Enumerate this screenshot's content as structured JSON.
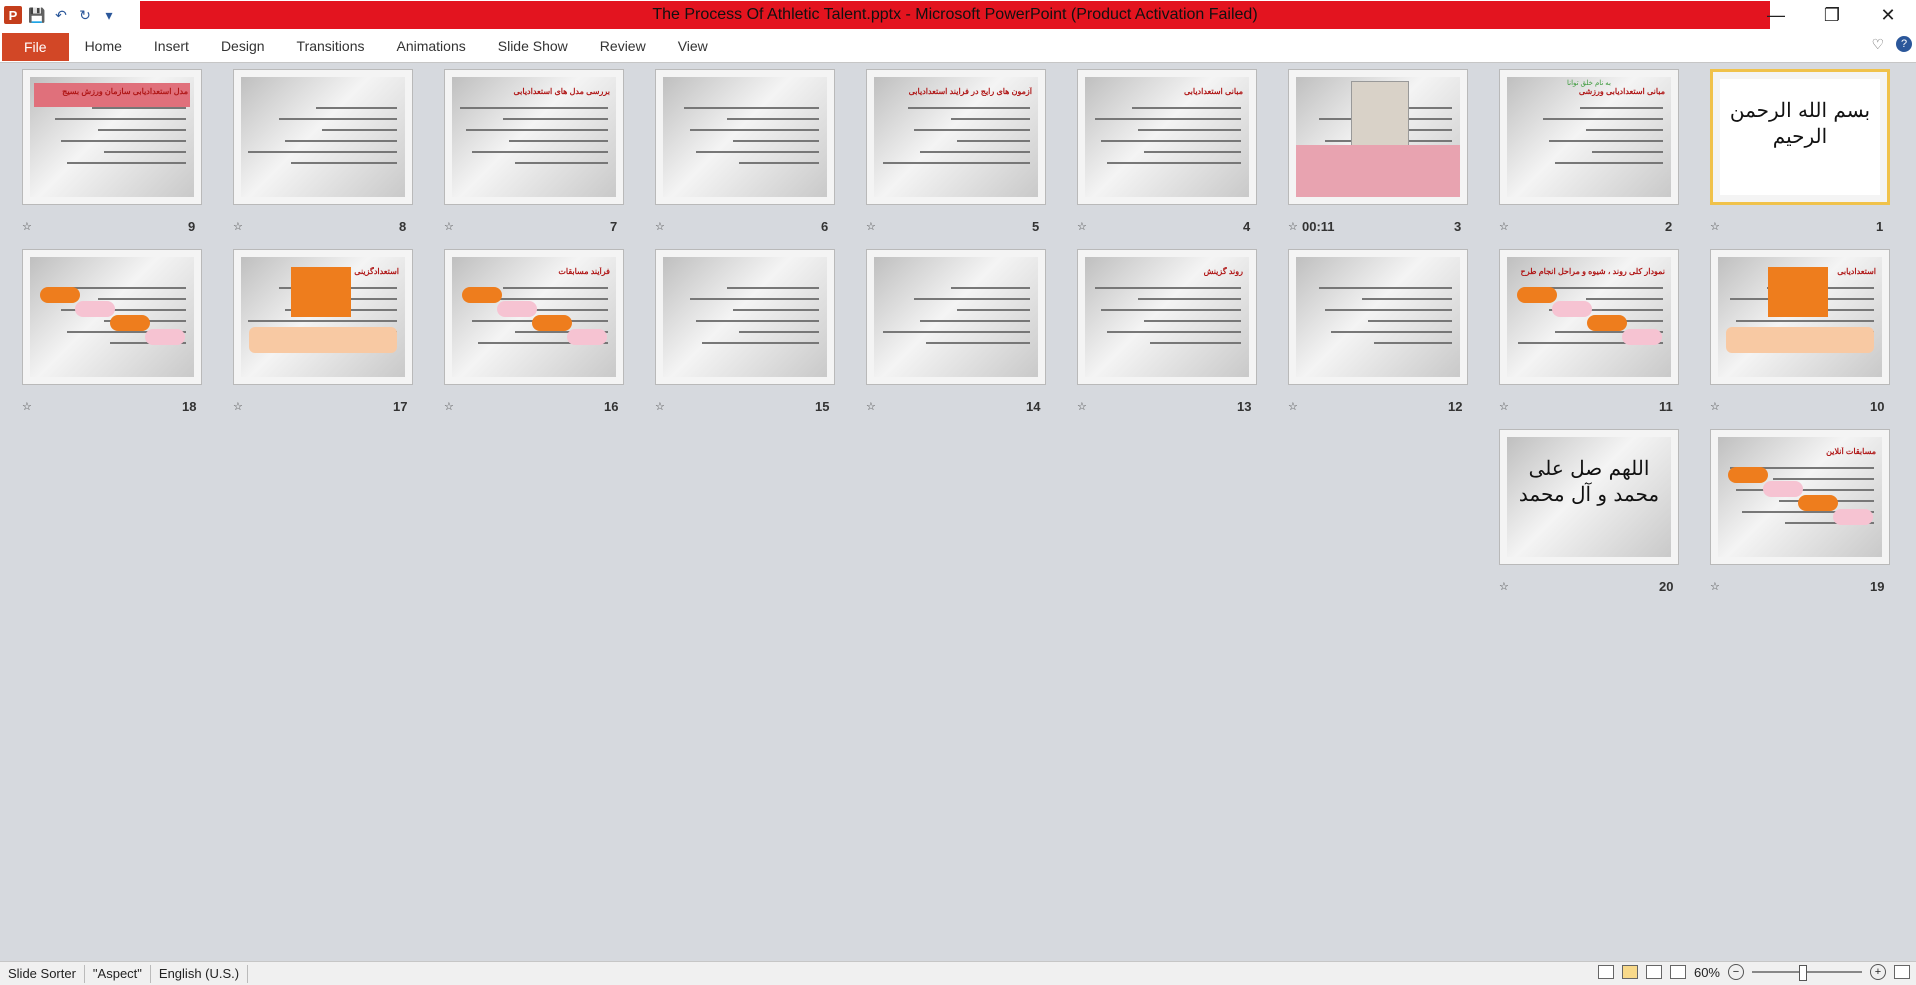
{
  "window": {
    "title": "The Process Of Athletic Talent.pptx  -  Microsoft PowerPoint (Product Activation Failed)",
    "controls": [
      "minimize",
      "restore",
      "close"
    ]
  },
  "qat": {
    "app_icon": "P",
    "save_icon": "save-icon",
    "undo_icon": "undo-icon",
    "redo_icon": "redo-icon"
  },
  "ribbon": {
    "file_label": "File",
    "tabs": [
      "Home",
      "Insert",
      "Design",
      "Transitions",
      "Animations",
      "Slide Show",
      "Review",
      "View"
    ],
    "help": "?"
  },
  "slides": [
    {
      "num": "1",
      "selected": true,
      "kind": "calligraphy",
      "caption": "بسم الله الرحمن الرحيم"
    },
    {
      "num": "2",
      "kind": "title",
      "caption": "مبانی استعدادیابی ورزشی",
      "sub": "به نام خلق توانا"
    },
    {
      "num": "3",
      "kind": "photo",
      "timing": "00:11",
      "caption": ""
    },
    {
      "num": "4",
      "kind": "text",
      "caption": "مبانی استعدادیابی"
    },
    {
      "num": "5",
      "kind": "text",
      "caption": "آزمون های رایج در فرایند استعدادیابی"
    },
    {
      "num": "6",
      "kind": "text",
      "caption": ""
    },
    {
      "num": "7",
      "kind": "text",
      "caption": "بررسی مدل های استعدادیابی"
    },
    {
      "num": "8",
      "kind": "text",
      "caption": ""
    },
    {
      "num": "9",
      "kind": "title-bar",
      "caption": "مدل استعدادیابی سازمان ورزش بسیج"
    },
    {
      "num": "10",
      "kind": "arrow",
      "caption": "استعدادیابی"
    },
    {
      "num": "11",
      "kind": "diagram",
      "caption": "نمودار کلی روند ، شیوه و مراحل انجام طرح"
    },
    {
      "num": "12",
      "kind": "text",
      "caption": ""
    },
    {
      "num": "13",
      "kind": "text",
      "caption": "روند گزینش"
    },
    {
      "num": "14",
      "kind": "text",
      "caption": ""
    },
    {
      "num": "15",
      "kind": "text",
      "caption": ""
    },
    {
      "num": "16",
      "kind": "diagram",
      "caption": "فرآیند مسابقات"
    },
    {
      "num": "17",
      "kind": "arrow",
      "caption": "استعدادگزینی"
    },
    {
      "num": "18",
      "kind": "diagram",
      "caption": ""
    },
    {
      "num": "19",
      "kind": "ellipses",
      "caption": "مسابقات آنلاین"
    },
    {
      "num": "20",
      "kind": "calligraphy",
      "caption": "اللهم صل علی محمد و آل محمد"
    }
  ],
  "status": {
    "view": "Slide Sorter",
    "theme": "\"Aspect\"",
    "language": "English (U.S.)",
    "zoom": "60%",
    "zoom_fraction": 0.45
  }
}
